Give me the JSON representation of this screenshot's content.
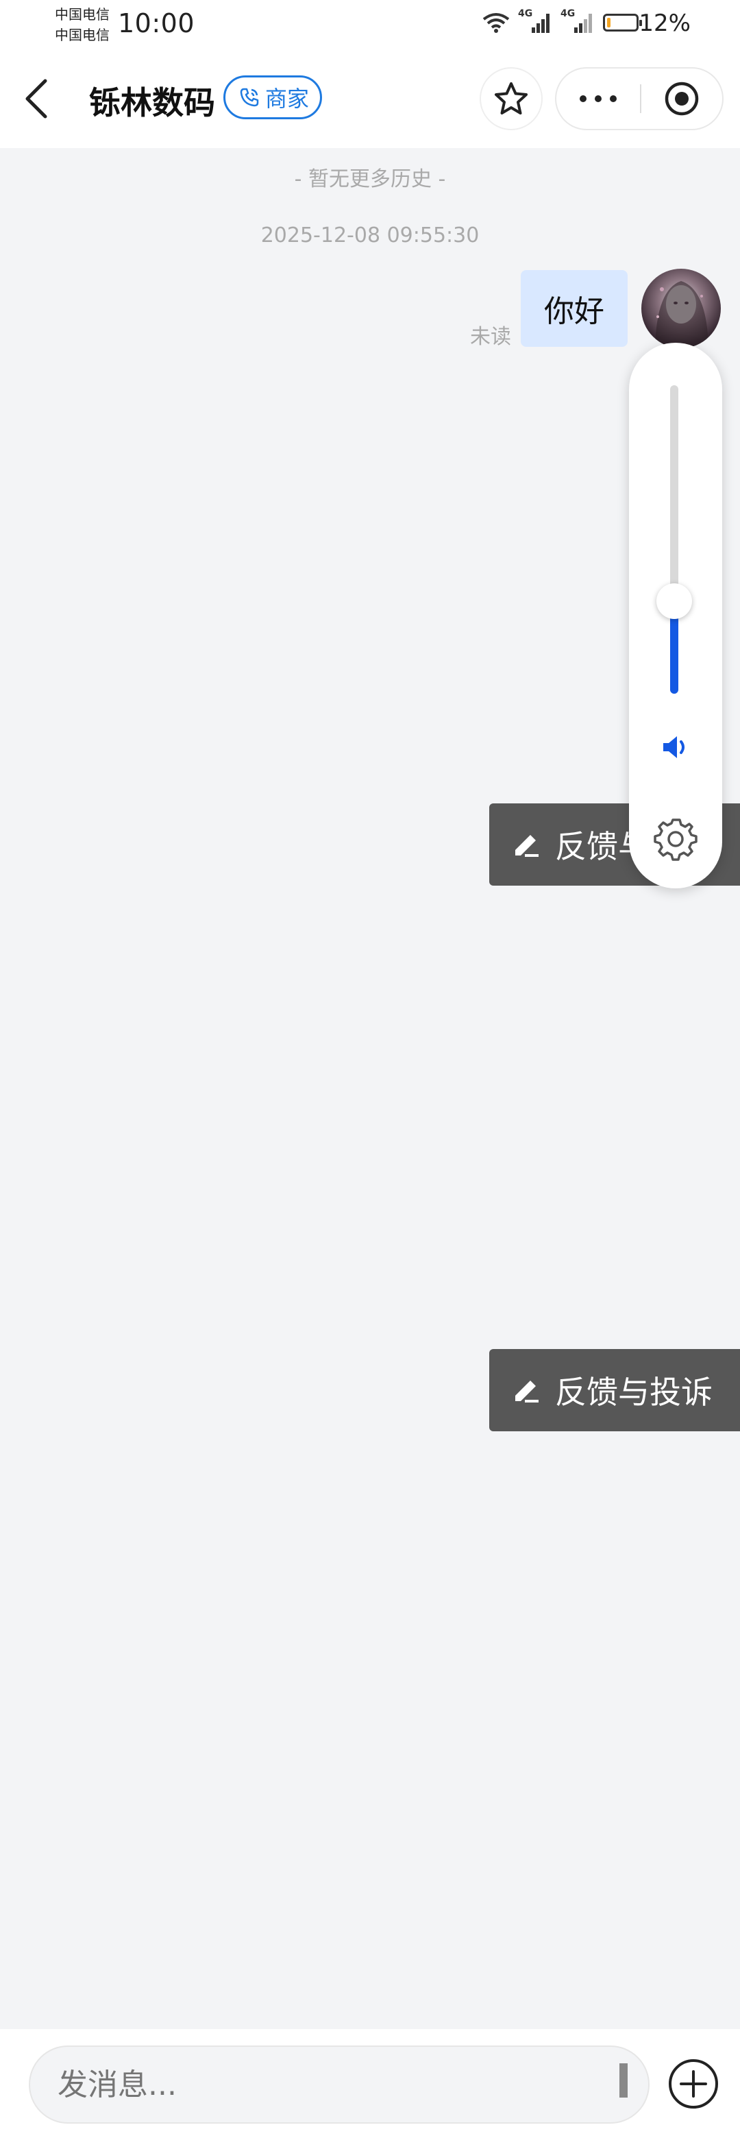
{
  "status_bar": {
    "carrier_1": "中国电信",
    "carrier_2": "中国电信",
    "time": "10:00",
    "network_1": "4G",
    "network_2": "4G",
    "battery_percent": "12%",
    "battery_level": 0.12,
    "battery_color": "#f5a623"
  },
  "nav": {
    "title": "铄林数码",
    "merchant_tag": "商家",
    "accent_color": "#1e7ae0",
    "icons": [
      "back-arrow-icon",
      "phone-icon",
      "star-icon",
      "more-dots-icon",
      "target-icon"
    ]
  },
  "chat": {
    "history_notice": "- 暂无更多历史 -",
    "timestamp": "2025-12-08 09:55:30",
    "messages": [
      {
        "text": "你好",
        "status": "未读",
        "from": "self"
      }
    ]
  },
  "volume_control": {
    "level": 0.3,
    "accent_color": "#1459e3",
    "icons": [
      "speaker-icon",
      "gear-icon"
    ]
  },
  "feedback": {
    "label": "反馈与投诉",
    "occluded_label": "反馈与"
  },
  "composer": {
    "placeholder": "发消息...",
    "value": ""
  }
}
